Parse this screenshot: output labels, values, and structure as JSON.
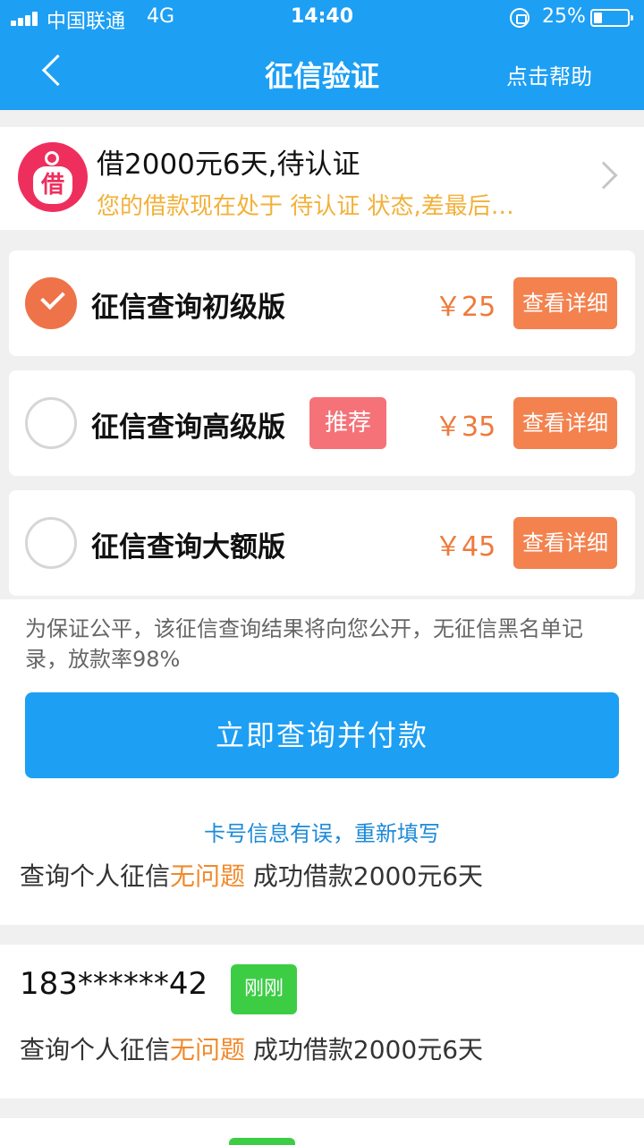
{
  "status_bar": {
    "carrier": "中国联通",
    "network": "4G",
    "time": "14:40",
    "battery_percent_label": "25%",
    "battery_level": 0.25
  },
  "nav": {
    "title": "征信验证",
    "help_label": "点击帮助"
  },
  "loan": {
    "logo_char": "借",
    "title": "借2000元6天,待认证",
    "description": "您的借款现在处于 待认证 状态,差最后…"
  },
  "options": [
    {
      "name": "征信查询初级版",
      "price": "￥25",
      "detail_label": "查看详细",
      "selected": true
    },
    {
      "name": "征信查询高级版",
      "badge": "推荐",
      "price": "￥35",
      "detail_label": "查看详细",
      "selected": false
    },
    {
      "name": "征信查询大额版",
      "price": "￥45",
      "detail_label": "查看详细",
      "selected": false
    }
  ],
  "notice": "为保证公平，该征信查询结果将向您公开，无征信黑名单记录，放款率98%",
  "pay_button_label": "立即查询并付款",
  "refill_link_label": "卡号信息有误，重新填写",
  "feed": {
    "partial": {
      "prefix": "查询个人征信",
      "highlight": "无问题",
      "suffix": " 成功借款2000元6天"
    },
    "items": [
      {
        "phone": "183******42",
        "tag": "刚刚",
        "prefix": "查询个人征信",
        "highlight": "无问题",
        "suffix": " 成功借款2000元6天"
      }
    ]
  },
  "colors": {
    "primary": "#1d9ff4",
    "accent_orange": "#f3824f",
    "recommend_badge": "#f47278",
    "tag_green": "#3ccd45",
    "warning_text": "#f2b13a",
    "logo_red": "#ee2f5e"
  },
  "icons": {
    "back": "chevron-left-icon",
    "forward": "chevron-right-icon",
    "check": "check-circle-icon",
    "lock": "orientation-lock-icon",
    "battery": "battery-icon",
    "signal": "signal-bars-icon"
  }
}
